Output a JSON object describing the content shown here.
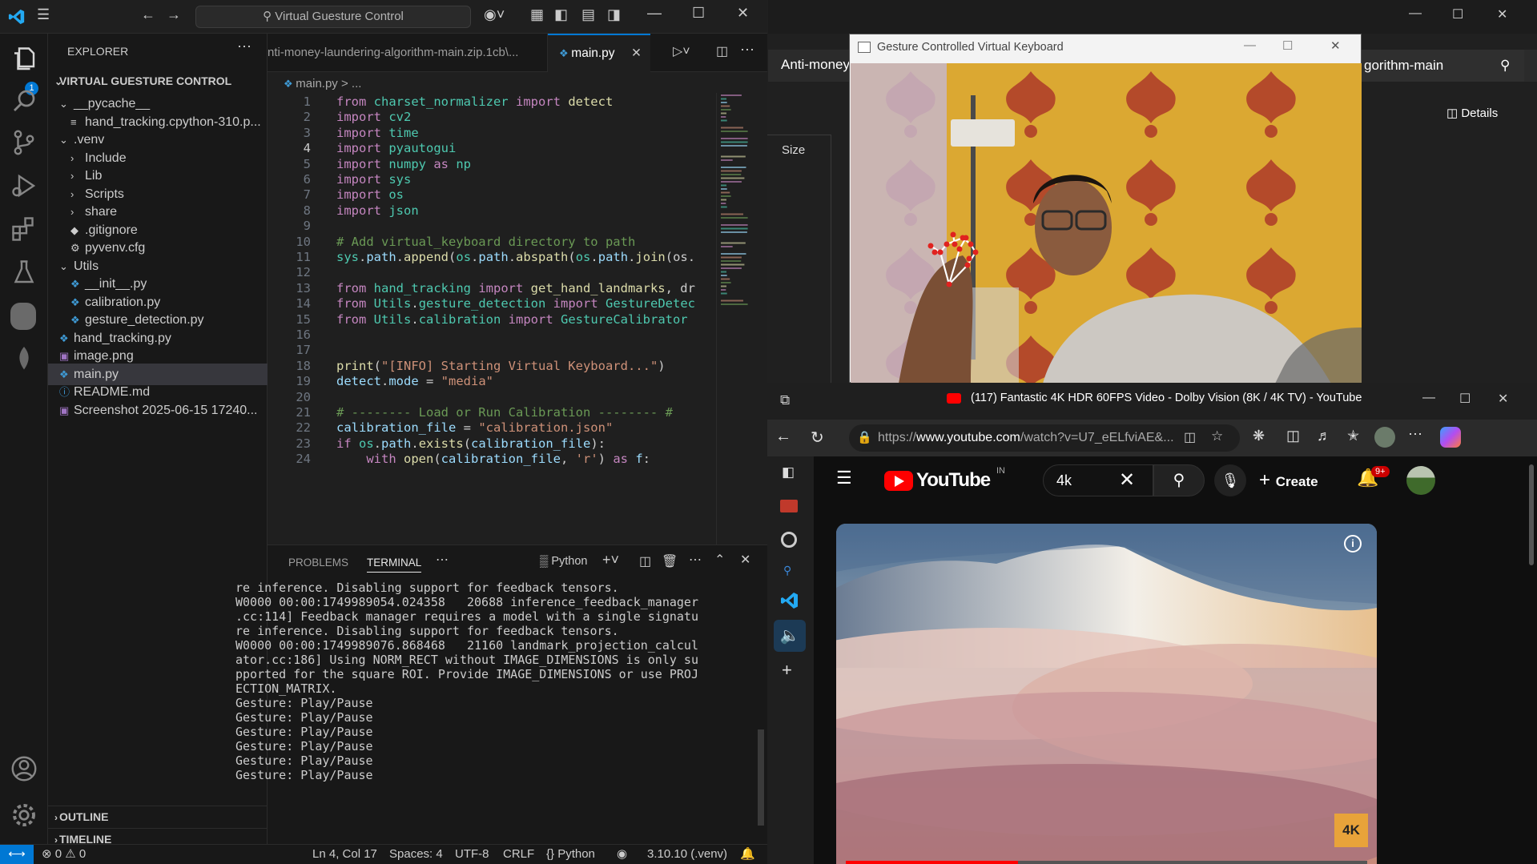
{
  "vscode": {
    "search_text": "Virtual Guesture Control",
    "explorer_title": "EXPLORER",
    "project_title": "VIRTUAL GUESTURE CONTROL",
    "tree": [
      {
        "label": "__pycache__",
        "type": "folder-open",
        "indent": 1
      },
      {
        "label": "hand_tracking.cpython-310.p...",
        "type": "file-lines",
        "indent": 2
      },
      {
        "label": ".venv",
        "type": "folder-open",
        "indent": 1
      },
      {
        "label": "Include",
        "type": "folder-closed",
        "indent": 2
      },
      {
        "label": "Lib",
        "type": "folder-closed",
        "indent": 2
      },
      {
        "label": "Scripts",
        "type": "folder-closed",
        "indent": 2
      },
      {
        "label": "share",
        "type": "folder-closed",
        "indent": 2
      },
      {
        "label": ".gitignore",
        "type": "git",
        "indent": 2
      },
      {
        "label": "pyvenv.cfg",
        "type": "gear",
        "indent": 2
      },
      {
        "label": "Utils",
        "type": "folder-open",
        "indent": 1
      },
      {
        "label": "__init__.py",
        "type": "python",
        "indent": 2
      },
      {
        "label": "calibration.py",
        "type": "python",
        "indent": 2
      },
      {
        "label": "gesture_detection.py",
        "type": "python",
        "indent": 2
      },
      {
        "label": "hand_tracking.py",
        "type": "python",
        "indent": 1
      },
      {
        "label": "image.png",
        "type": "image",
        "indent": 1
      },
      {
        "label": "main.py",
        "type": "python",
        "indent": 1,
        "selected": true
      },
      {
        "label": "README.md",
        "type": "info",
        "indent": 1
      },
      {
        "label": "Screenshot 2025-06-15 17240...",
        "type": "image",
        "indent": 1
      }
    ],
    "outline_label": "OUTLINE",
    "timeline_label": "TIMELINE",
    "tab_inactive": "nti-money-laundering-algorithm-main.zip.1cb\\...",
    "tab_active": "main.py",
    "breadcrumb": "main.py > ...",
    "code": [
      [
        [
          "kw",
          "from "
        ],
        [
          "mod",
          "charset_normalizer "
        ],
        [
          "kw",
          "import "
        ],
        [
          "fn",
          "detect"
        ]
      ],
      [
        [
          "kw",
          "import "
        ],
        [
          "mod",
          "cv2"
        ]
      ],
      [
        [
          "kw",
          "import "
        ],
        [
          "mod",
          "time"
        ]
      ],
      [
        [
          "kw",
          "import "
        ],
        [
          "mod",
          "pyautogui"
        ]
      ],
      [
        [
          "kw",
          "import "
        ],
        [
          "mod",
          "numpy "
        ],
        [
          "kw",
          "as "
        ],
        [
          "mod",
          "np"
        ]
      ],
      [
        [
          "kw",
          "import "
        ],
        [
          "mod",
          "sys"
        ]
      ],
      [
        [
          "kw",
          "import "
        ],
        [
          "mod",
          "os"
        ]
      ],
      [
        [
          "kw",
          "import "
        ],
        [
          "mod",
          "json"
        ]
      ],
      [],
      [
        [
          "cm",
          "# Add virtual_keyboard directory to path"
        ]
      ],
      [
        [
          "mod",
          "sys"
        ],
        [
          "pl",
          "."
        ],
        [
          "var",
          "path"
        ],
        [
          "pl",
          "."
        ],
        [
          "fn",
          "append"
        ],
        [
          "pl",
          "("
        ],
        [
          "mod",
          "os"
        ],
        [
          "pl",
          "."
        ],
        [
          "var",
          "path"
        ],
        [
          "pl",
          "."
        ],
        [
          "fn",
          "abspath"
        ],
        [
          "pl",
          "("
        ],
        [
          "mod",
          "os"
        ],
        [
          "pl",
          "."
        ],
        [
          "var",
          "path"
        ],
        [
          "pl",
          "."
        ],
        [
          "fn",
          "join"
        ],
        [
          "pl",
          "(os."
        ]
      ],
      [],
      [
        [
          "kw",
          "from "
        ],
        [
          "mod",
          "hand_tracking "
        ],
        [
          "kw",
          "import "
        ],
        [
          "fn",
          "get_hand_landmarks"
        ],
        [
          "pl",
          ", dr"
        ]
      ],
      [
        [
          "kw",
          "from "
        ],
        [
          "mod",
          "Utils"
        ],
        [
          "pl",
          "."
        ],
        [
          "mod",
          "gesture_detection "
        ],
        [
          "kw",
          "import "
        ],
        [
          "mod",
          "GestureDetec"
        ]
      ],
      [
        [
          "kw",
          "from "
        ],
        [
          "mod",
          "Utils"
        ],
        [
          "pl",
          "."
        ],
        [
          "mod",
          "calibration "
        ],
        [
          "kw",
          "import "
        ],
        [
          "mod",
          "GestureCalibrator"
        ]
      ],
      [],
      [],
      [
        [
          "fn",
          "print"
        ],
        [
          "pl",
          "("
        ],
        [
          "str",
          "\"[INFO] Starting Virtual Keyboard...\""
        ],
        [
          "pl",
          ")"
        ]
      ],
      [
        [
          "var",
          "detect"
        ],
        [
          "pl",
          "."
        ],
        [
          "var",
          "mode"
        ],
        [
          "pl",
          " = "
        ],
        [
          "str",
          "\"media\""
        ]
      ],
      [],
      [
        [
          "cm",
          "# -------- Load or Run Calibration -------- #"
        ]
      ],
      [
        [
          "var",
          "calibration_file"
        ],
        [
          "pl",
          " = "
        ],
        [
          "str",
          "\"calibration.json\""
        ]
      ],
      [
        [
          "kw",
          "if "
        ],
        [
          "mod",
          "os"
        ],
        [
          "pl",
          "."
        ],
        [
          "var",
          "path"
        ],
        [
          "pl",
          "."
        ],
        [
          "fn",
          "exists"
        ],
        [
          "pl",
          "("
        ],
        [
          "var",
          "calibration_file"
        ],
        [
          "pl",
          "):"
        ]
      ],
      [
        [
          "pl",
          "    "
        ],
        [
          "kw",
          "with "
        ],
        [
          "fn",
          "open"
        ],
        [
          "pl",
          "("
        ],
        [
          "var",
          "calibration_file"
        ],
        [
          "pl",
          ", "
        ],
        [
          "str",
          "'r'"
        ],
        [
          "pl",
          ") "
        ],
        [
          "kw",
          "as "
        ],
        [
          "var",
          "f"
        ],
        [
          "pl",
          ":"
        ]
      ]
    ],
    "panel_tabs": [
      "PROBLEMS",
      "TERMINAL"
    ],
    "panel_active": "TERMINAL",
    "terminal_profile": "Python",
    "terminal": [
      "re inference. Disabling support for feedback tensors.",
      "W0000 00:00:1749989054.024358   20688 inference_feedback_manager",
      ".cc:114] Feedback manager requires a model with a single signatu",
      "re inference. Disabling support for feedback tensors.",
      "W0000 00:00:1749989076.868468   21160 landmark_projection_calcul",
      "ator.cc:186] Using NORM_RECT without IMAGE_DIMENSIONS is only su",
      "pported for the square ROI. Provide IMAGE_DIMENSIONS or use PROJ",
      "ECTION_MATRIX.",
      "Gesture: Play/Pause",
      "Gesture: Play/Pause",
      "Gesture: Play/Pause",
      "Gesture: Play/Pause",
      "Gesture: Play/Pause",
      "Gesture: Play/Pause"
    ],
    "status": {
      "errors": "0",
      "warnings": "0",
      "position": "Ln 4, Col 17",
      "spaces": "Spaces: 4",
      "encoding": "UTF-8",
      "eol": "CRLF",
      "language": "Python",
      "interpreter": "3.10.10 (.venv)"
    },
    "accounts_badge": "1"
  },
  "file_explorer": {
    "title_partial": "Anti-money",
    "title_right": "gorithm-main",
    "details_label": "Details",
    "size_header": "Size"
  },
  "keyboard_window": {
    "title": "Gesture Controlled Virtual Keyboard"
  },
  "edge": {
    "tab_title": "(117) Fantastic 4K HDR 60FPS Video - Dolby Vision (8K / 4K TV) - YouTube",
    "url_prefix": "https://",
    "url_host": "www.youtube.com",
    "url_rest": "/watch?v=U7_eELfviAE&...",
    "youtube": {
      "logo_text": "YouTube",
      "country": "IN",
      "search_value": "4k",
      "create_label": "Create",
      "notif_badge": "9+",
      "quality_badge": "4K"
    }
  },
  "colors": {
    "vscode_bg": "#1f1f1f",
    "accent_blue": "#0078d4",
    "youtube_red": "#ff0000",
    "wall_yellow": "#d9a52b"
  }
}
